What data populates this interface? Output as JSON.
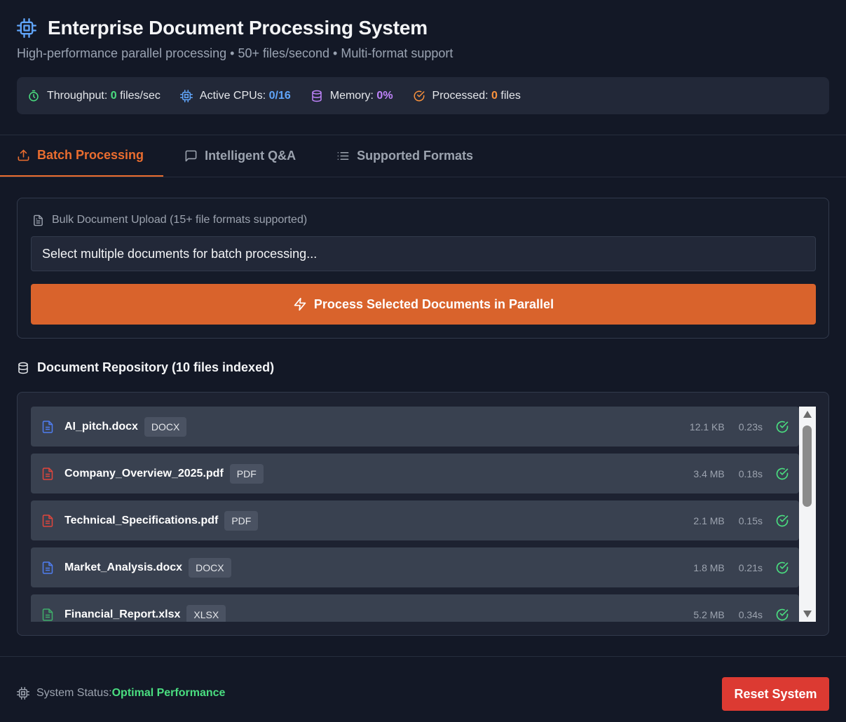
{
  "header": {
    "title": "Enterprise Document Processing System",
    "subtitle": "High-performance parallel processing • 50+ files/second • Multi-format support"
  },
  "stats": {
    "throughput_label": "Throughput:",
    "throughput_value": "0",
    "throughput_unit": "files/sec",
    "cpus_label": "Active CPUs:",
    "cpus_value": "0/16",
    "memory_label": "Memory:",
    "memory_value": "0%",
    "processed_label": "Processed:",
    "processed_value": "0",
    "processed_unit": "files"
  },
  "tabs": [
    {
      "label": "Batch Processing",
      "icon": "upload-icon",
      "active": true
    },
    {
      "label": "Intelligent Q&A",
      "icon": "message-icon",
      "active": false
    },
    {
      "label": "Supported Formats",
      "icon": "list-icon",
      "active": false
    }
  ],
  "upload": {
    "label": "Bulk Document Upload (15+ file formats supported)",
    "placeholder": "Select multiple documents for batch processing...",
    "button_label": "Process Selected Documents in Parallel"
  },
  "repository": {
    "title": "Document Repository (10 files indexed)",
    "files": [
      {
        "name": "AI_pitch.docx",
        "type": "DOCX",
        "size": "12.1 KB",
        "time": "0.23s",
        "color": "#4f7df0"
      },
      {
        "name": "Company_Overview_2025.pdf",
        "type": "PDF",
        "size": "3.4 MB",
        "time": "0.18s",
        "color": "#e0463c"
      },
      {
        "name": "Technical_Specifications.pdf",
        "type": "PDF",
        "size": "2.1 MB",
        "time": "0.15s",
        "color": "#e0463c"
      },
      {
        "name": "Market_Analysis.docx",
        "type": "DOCX",
        "size": "1.8 MB",
        "time": "0.21s",
        "color": "#4f7df0"
      },
      {
        "name": "Financial_Report.xlsx",
        "type": "XLSX",
        "size": "5.2 MB",
        "time": "0.34s",
        "color": "#3fae6a"
      }
    ]
  },
  "footer": {
    "status_label": "System Status:",
    "status_value": "Optimal Performance",
    "reset_label": "Reset System"
  },
  "colors": {
    "accent": "#d9632c",
    "success": "#4ade80",
    "danger": "#dc3a32",
    "background": "#131826"
  }
}
